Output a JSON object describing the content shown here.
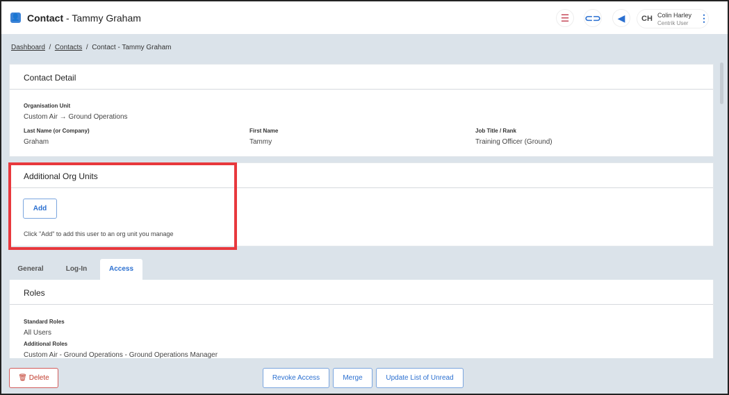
{
  "header": {
    "title_prefix": "Contact",
    "title_sep": "-",
    "title_name": "Tammy Graham",
    "user_initials": "CH",
    "user_name": "Colin Harley",
    "user_role": "Centrik User",
    "icons": [
      "stack-icon",
      "link-icon",
      "megaphone-icon",
      "more-vertical-icon"
    ]
  },
  "breadcrumb": {
    "items": [
      "Dashboard",
      "Contacts"
    ],
    "current": "Contact - Tammy Graham"
  },
  "contact_detail": {
    "title": "Contact Detail",
    "org_unit_label": "Organisation Unit",
    "org_unit_value": "Custom Air → Ground Operations",
    "last_name_label": "Last Name (or Company)",
    "last_name_value": "Graham",
    "first_name_label": "First Name",
    "first_name_value": "Tammy",
    "job_label": "Job Title / Rank",
    "job_value": "Training Officer (Ground)"
  },
  "additional_org": {
    "title": "Additional Org Units",
    "add_label": "Add",
    "hint": "Click \"Add\" to add this user to an org unit you manage"
  },
  "tabs": [
    "General",
    "Log-In",
    "Access"
  ],
  "roles": {
    "title": "Roles",
    "standard_label": "Standard Roles",
    "standard_value": "All Users",
    "additional_label": "Additional Roles",
    "additional_value": "Custom Air - Ground Operations - Ground Operations Manager"
  },
  "footer": {
    "delete": "Delete",
    "revoke": "Revoke Access",
    "merge": "Merge",
    "update": "Update List of Unread"
  },
  "colors": {
    "accent": "#2a6fd0",
    "danger": "#c0392b",
    "highlight": "#e8383d"
  }
}
